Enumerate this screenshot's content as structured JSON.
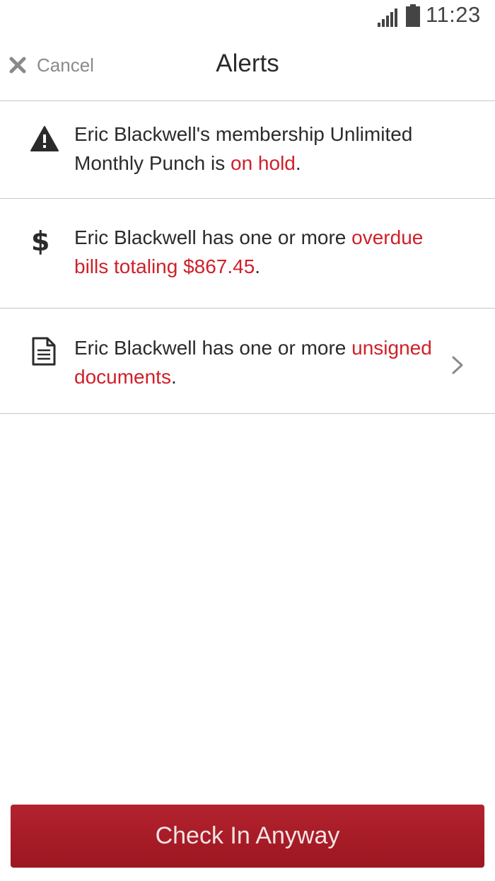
{
  "status_bar": {
    "time": "11:23",
    "icons": [
      "signal-icon",
      "battery-icon"
    ]
  },
  "header": {
    "cancel_label": "Cancel",
    "title": "Alerts"
  },
  "alerts": [
    {
      "icon": "warning-icon",
      "text_before": "Eric Blackwell's membership Unlimited Monthly Punch is ",
      "highlight": "on hold",
      "text_after": "."
    },
    {
      "icon": "dollar-icon",
      "text_before": "Eric Blackwell has one or more ",
      "highlight": "overdue bills totaling $867.45",
      "text_after": "."
    },
    {
      "icon": "document-icon",
      "text_before": "Eric Blackwell has one or more ",
      "highlight": "unsigned documents",
      "text_after": ".",
      "has_chevron": true
    }
  ],
  "footer": {
    "checkin_label": "Check In Anyway"
  },
  "colors": {
    "accent_red": "#d0202a",
    "button_red": "#a81c26",
    "divider": "#c8c8c8"
  }
}
